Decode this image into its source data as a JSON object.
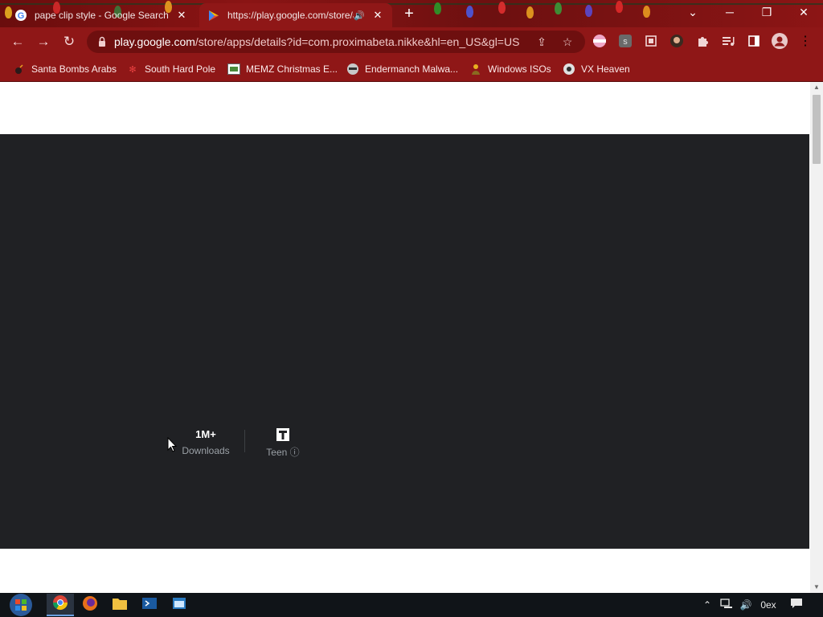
{
  "browser": {
    "tabs": [
      {
        "title": "pape clip style - Google Search",
        "state": "inactive",
        "favicon": "google-g-icon"
      },
      {
        "title": "https://play.google.com/store/apps/details?id=com.proximabeta.nikke&hl=en_US&gl=US",
        "state": "active",
        "favicon": "google-play-icon",
        "audio": "speaker-icon"
      }
    ],
    "new_tab_glyph": "+",
    "window_controls": {
      "dropdown": "⌄",
      "minimize": "─",
      "restore": "❐",
      "close": "✕"
    },
    "nav": {
      "back": "←",
      "forward": "→",
      "reload": "↻"
    },
    "address": {
      "host": "play.google.com",
      "path": "/store/apps/details?id=com.proximabeta.nikke&hl=en_US&gl=US"
    },
    "menu_glyph": "⋮",
    "bookmarks": [
      {
        "label": "Santa Bombs Arabs",
        "icon": "bomb-icon"
      },
      {
        "label": "South Hard Pole",
        "icon": "snowflake-icon"
      },
      {
        "label": "MEMZ Christmas E...",
        "icon": "image-icon"
      },
      {
        "label": "Endermanch Malwa...",
        "icon": "raccoon-icon"
      },
      {
        "label": "Windows ISOs",
        "icon": "person-icon"
      },
      {
        "label": "VX Heaven",
        "icon": "vx-logo-icon"
      }
    ],
    "accent": "#8f1717"
  },
  "page": {
    "stats": [
      {
        "value": "1M+",
        "label": "Downloads"
      },
      {
        "value": "",
        "label": "Teen",
        "icon": "teen-rating-icon",
        "info_icon": "info-icon"
      }
    ],
    "hero_color": "#202124"
  },
  "taskbar": {
    "apps": [
      "chrome-icon",
      "firefox-icon",
      "file-explorer-icon",
      "powershell-icon",
      "window-app-icon"
    ],
    "clock": "0ex"
  }
}
